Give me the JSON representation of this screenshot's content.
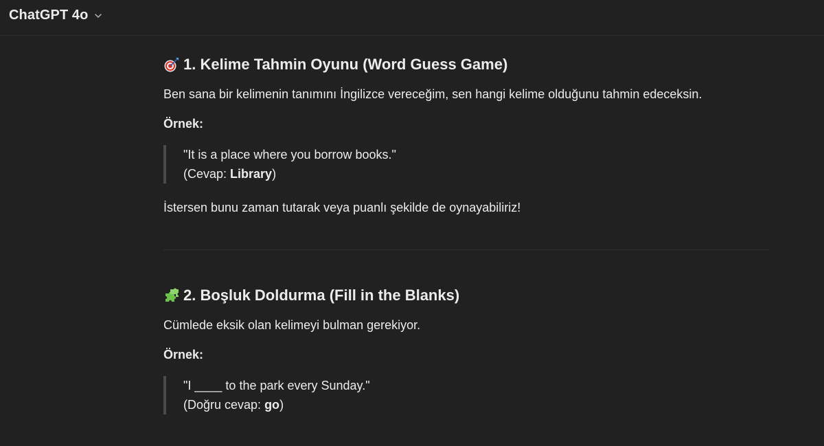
{
  "header": {
    "model_name": "ChatGPT 4o",
    "chevron_icon": "chevron-down-icon"
  },
  "sections": [
    {
      "icon": "dart-target-icon",
      "title": "1. Kelime Tahmin Oyunu (Word Guess Game)",
      "description": "Ben sana bir kelimenin tanımını İngilizce vereceğim, sen hangi kelime olduğunu tahmin edeceksin.",
      "example_label": "Örnek:",
      "quote_line1": "\"It is a place where you borrow books.\"",
      "answer_prefix": "(Cevap: ",
      "answer_bold": "Library",
      "answer_suffix": ")",
      "note": "İstersen bunu zaman tutarak veya puanlı şekilde de oynayabiliriz!"
    },
    {
      "icon": "puzzle-piece-icon",
      "title": "2. Boşluk Doldurma (Fill in the Blanks)",
      "description": "Cümlede eksik olan kelimeyi bulman gerekiyor.",
      "example_label": "Örnek:",
      "quote_line1": "\"I ____ to the park every Sunday.\"",
      "answer_prefix": "(Doğru cevap: ",
      "answer_bold": "go",
      "answer_suffix": ")"
    }
  ],
  "colors": {
    "background": "#212121",
    "text": "#ececec",
    "quote_border": "#4a4a4a",
    "divider": "#303030"
  }
}
